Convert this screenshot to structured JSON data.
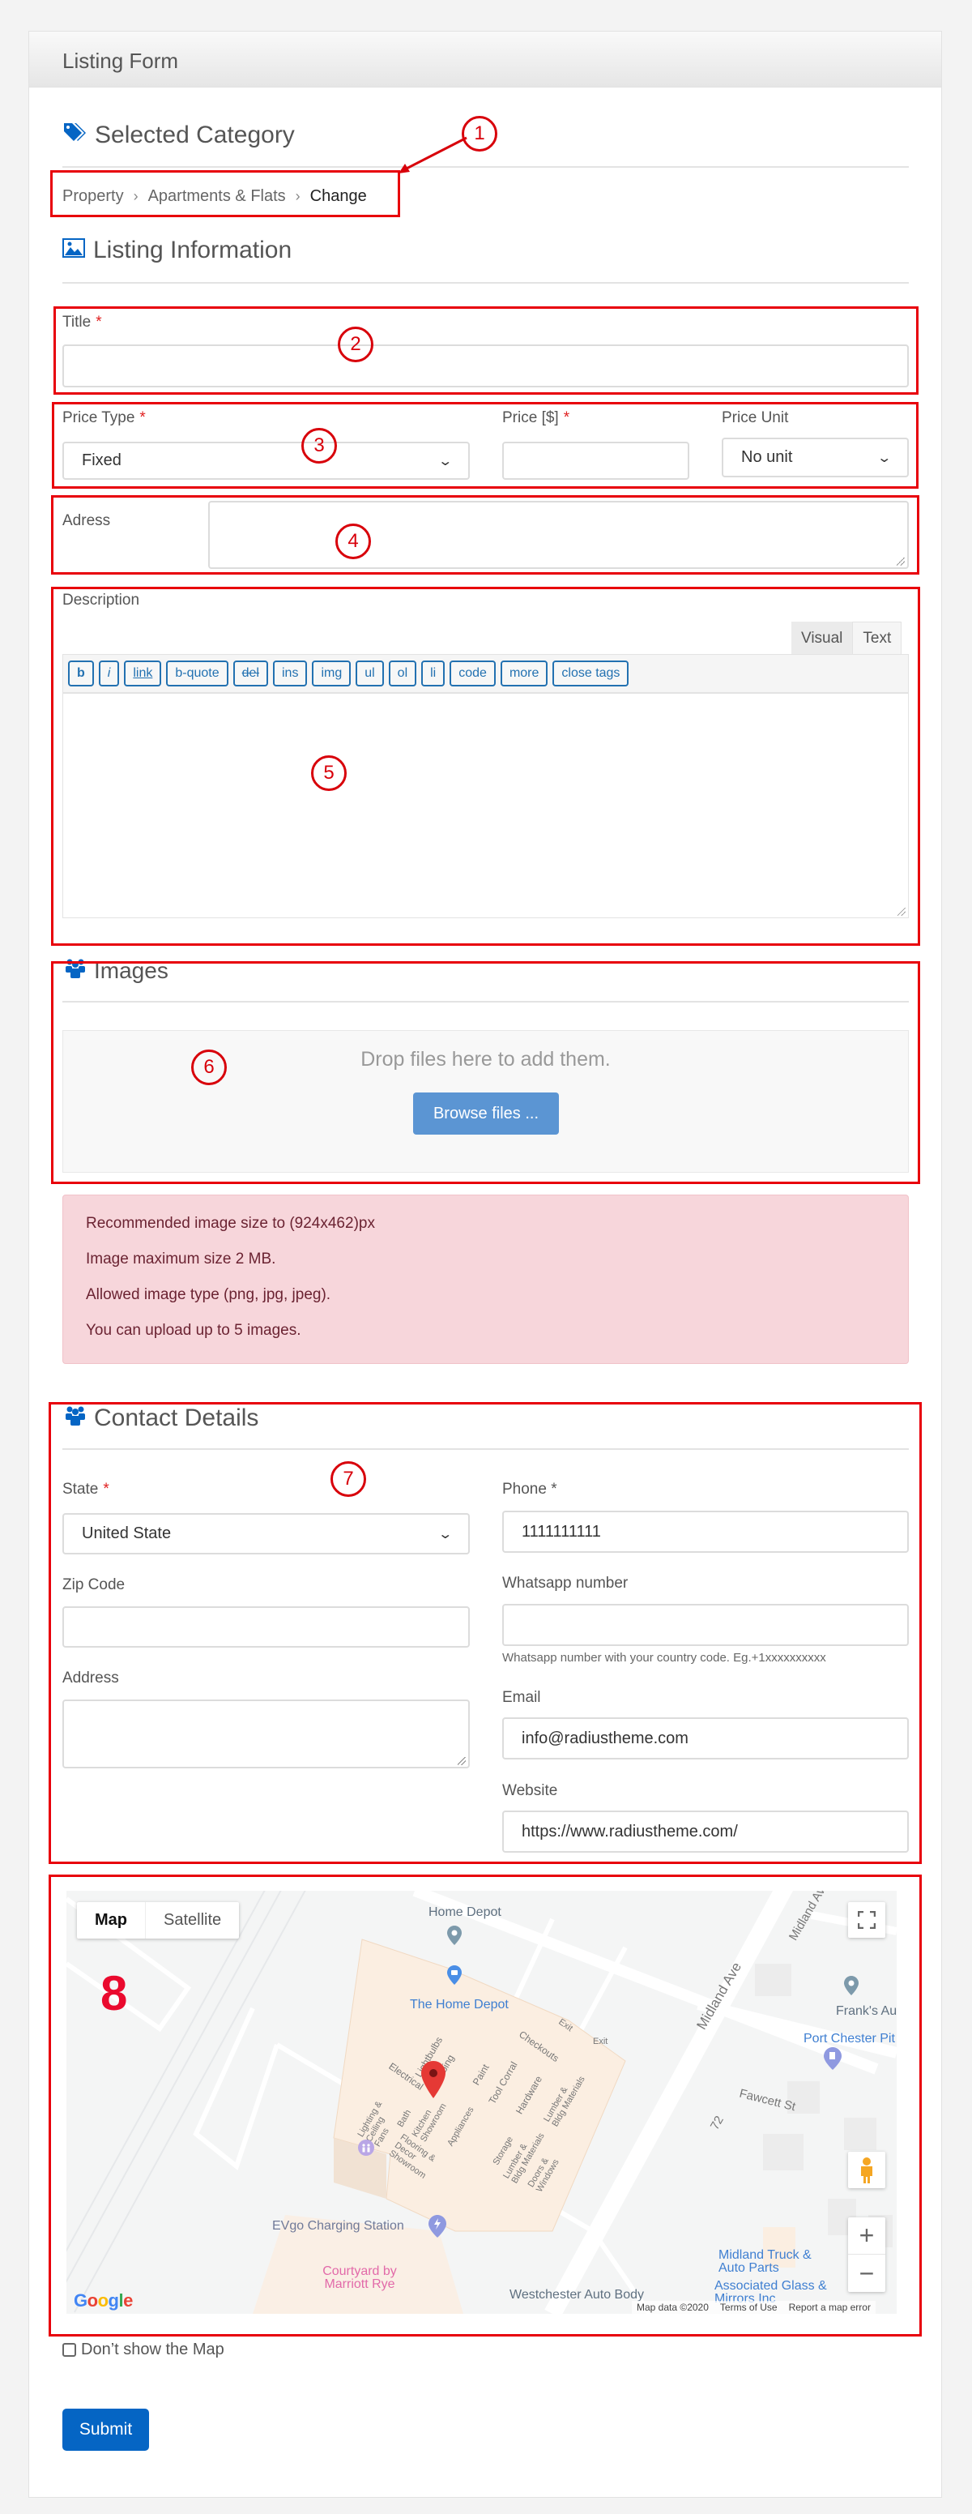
{
  "header": {
    "title": "Listing Form"
  },
  "selected_category": {
    "heading": "Selected Category",
    "icon": "tags-icon",
    "breadcrumb": [
      "Property",
      "Apartments & Flats"
    ],
    "separator": "›",
    "change_label": "Change"
  },
  "listing_information": {
    "heading": "Listing Information",
    "icon": "image-icon",
    "title_label": "Title",
    "title_value": "",
    "required_marker": "*",
    "price_type_label": "Price Type",
    "price_type_value": "Fixed",
    "price_label": "Price [$]",
    "price_value": "",
    "price_unit_label": "Price Unit",
    "price_unit_value": "No unit",
    "address_label": "Adress",
    "address_value": "",
    "description_label": "Description",
    "editor_tabs": [
      "Visual",
      "Text"
    ],
    "quicktags": [
      "b",
      "i",
      "link",
      "b-quote",
      "del",
      "ins",
      "img",
      "ul",
      "ol",
      "li",
      "code",
      "more",
      "close tags"
    ],
    "description_value": ""
  },
  "images": {
    "heading": "Images",
    "icon": "users-icon",
    "drop_text": "Drop files here to add them.",
    "browse_label": "Browse files ...",
    "notes": [
      "Recommended image size to (924x462)px",
      "Image maximum size 2 MB.",
      "Allowed image type (png, jpg, jpeg).",
      "You can upload up to 5 images."
    ]
  },
  "contact": {
    "heading": "Contact Details",
    "icon": "users-icon",
    "state_label": "State",
    "state_value": "United State",
    "phone_label": "Phone *",
    "phone_value": "1111111111",
    "zip_label": "Zip Code",
    "zip_value": "",
    "whatsapp_label": "Whatsapp number",
    "whatsapp_value": "",
    "whatsapp_hint": "Whatsapp number with your country code. Eg.+1xxxxxxxxxx",
    "address_label": "Address",
    "address_value": "",
    "email_label": "Email",
    "email_value": "info@radiustheme.com",
    "website_label": "Website",
    "website_value": "https://www.radiustheme.com/"
  },
  "map": {
    "type_buttons": [
      "Map",
      "Satellite"
    ],
    "active_type": "Map",
    "labels": {
      "home_depot_top": "Home Depot",
      "the_home_depot": "The Home Depot",
      "electrical": "Electrical",
      "lightbulbs": "Lightbulbs",
      "plumbing": "Plumbing",
      "paint": "Paint",
      "tool_corral": "Tool Corral",
      "hardware": "Hardware",
      "checkouts": "Checkouts",
      "exit1": "Exit",
      "exit2": "Exit",
      "lighting": "Lighting & Ceiling Fans",
      "bath": "Bath",
      "kitchen": "Kitchen Showroom",
      "appliances": "Appliances",
      "storage": "Storage",
      "lumber1": "Lumber & Bldg Materials",
      "lumber2": "Lumber & Bldg Materials",
      "doors": "Doors & Windows",
      "flooring": "Flooring & Decor Showroom",
      "midland_ave": "Midland Ave",
      "midland_ave_top": "Midland Av",
      "route": "72",
      "fawcett": "Fawcett St",
      "franks": "Frank's Aut",
      "port_chester": "Port Chester Pit S",
      "evgo": "EVgo Charging Station",
      "courtyard": "Courtyard by Marriott Rye",
      "midland_truck": "Midland Truck & Auto Parts",
      "associated_glass": "Associated Glass & Mirrors Inc",
      "westchester": "Westchester Auto Body"
    },
    "google_logo": "Google",
    "footer": [
      "Map data ©2020",
      "Terms of Use",
      "Report a map error"
    ],
    "zoom_in": "+",
    "zoom_out": "−"
  },
  "dont_show_map_label": "Don’t show the Map",
  "dont_show_map_checked": false,
  "submit_label": "Submit",
  "annotations": [
    "1",
    "2",
    "3",
    "4",
    "5",
    "6",
    "7",
    "8"
  ],
  "colors": {
    "accent": "#0565c4",
    "annotation": "#e8000b",
    "alert_bg": "#f7d6db",
    "browse_button": "#5b95d3"
  }
}
